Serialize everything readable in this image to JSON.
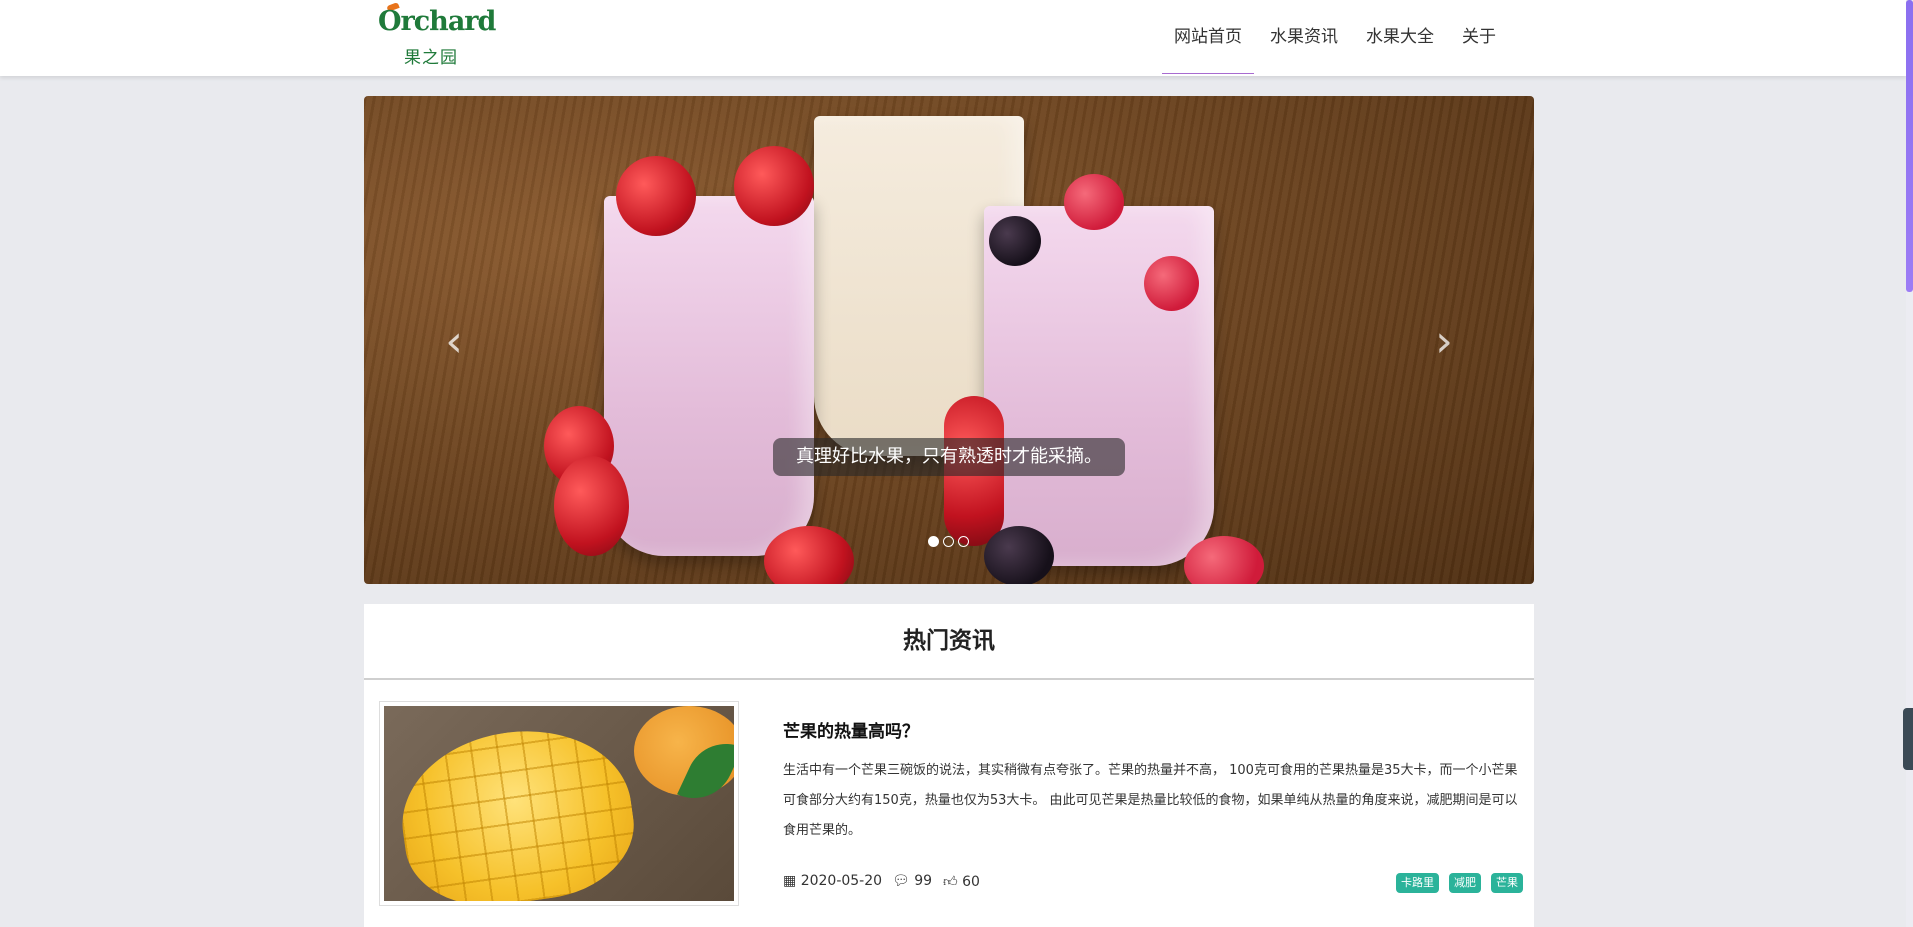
{
  "brand": {
    "logo_en": "Orchard",
    "logo_cn": "果之园"
  },
  "nav": [
    {
      "label": "网站首页",
      "active": true
    },
    {
      "label": "水果资讯",
      "active": false
    },
    {
      "label": "水果大全",
      "active": false
    },
    {
      "label": "关于",
      "active": false
    }
  ],
  "carousel": {
    "caption": "真理好比水果，只有熟透时才能采摘。",
    "prev_icon": "chevron-left-icon",
    "next_icon": "chevron-right-icon",
    "slide_count": 3,
    "active_slide": 1
  },
  "section": {
    "title": "热门资讯",
    "articles": [
      {
        "title": "芒果的热量高吗？",
        "summary": "生活中有一个芒果三碗饭的说法，其实稍微有点夸张了。芒果的热量并不高， 100克可食用的芒果热量是35大卡，而一个小芒果可食部分大约有150克，热量也仅为53大卡。 由此可见芒果是热量比较低的食物，如果单纯从热量的角度来说，减肥期间是可以食用芒果的。",
        "date": "2020-05-20",
        "comments": "99",
        "likes": "60",
        "tags": [
          "卡路里",
          "减肥",
          "芒果"
        ]
      }
    ]
  },
  "colors": {
    "accent": "#a86bd0",
    "tag": "#2bb39a",
    "brand_green": "#1f7a3a",
    "brand_orange": "#e8731b"
  }
}
